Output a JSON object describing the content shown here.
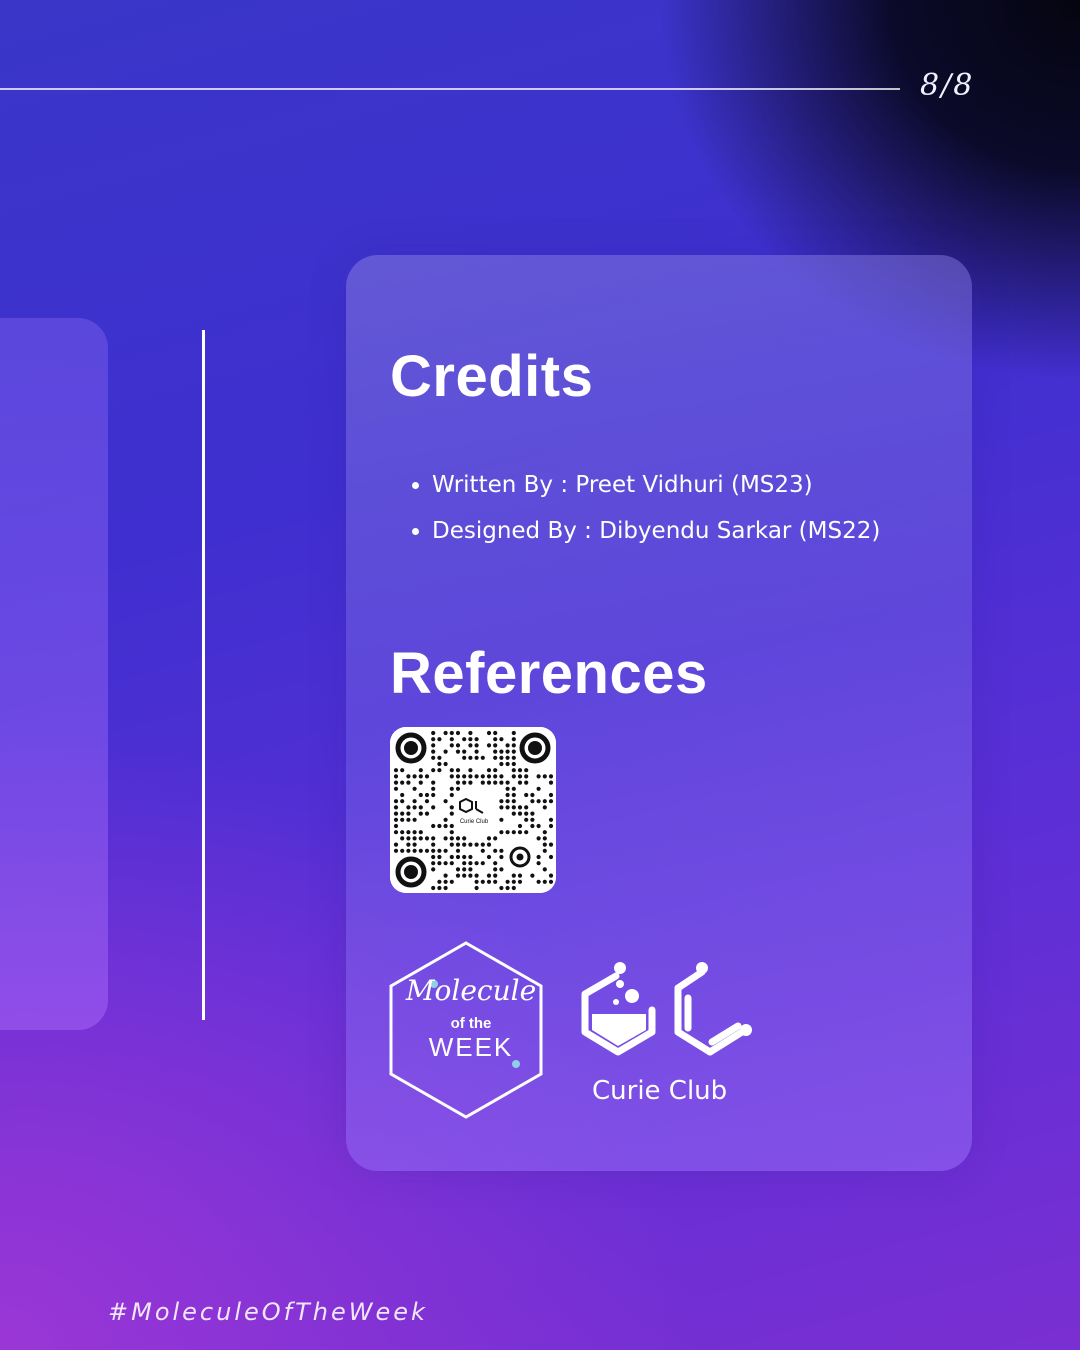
{
  "header": {
    "page_indicator": "8/8"
  },
  "credits": {
    "heading": "Credits",
    "items": [
      "Written By : Preet Vidhuri (MS23)",
      "Designed By : Dibyendu Sarkar (MS22)"
    ]
  },
  "references": {
    "heading": "References",
    "qr_center_label": "Curie Club"
  },
  "logos": {
    "molecule_of_the_week": {
      "line1": "Molecule",
      "line2": "of the",
      "line3": "WEEK"
    },
    "curie_club": {
      "label": "Curie Club"
    }
  },
  "footer": {
    "hashtag": "#MoleculeOfTheWeek"
  },
  "colors": {
    "background_top": "#3a36c8",
    "background_bottom": "#9b36d6",
    "text": "#ffffff"
  }
}
